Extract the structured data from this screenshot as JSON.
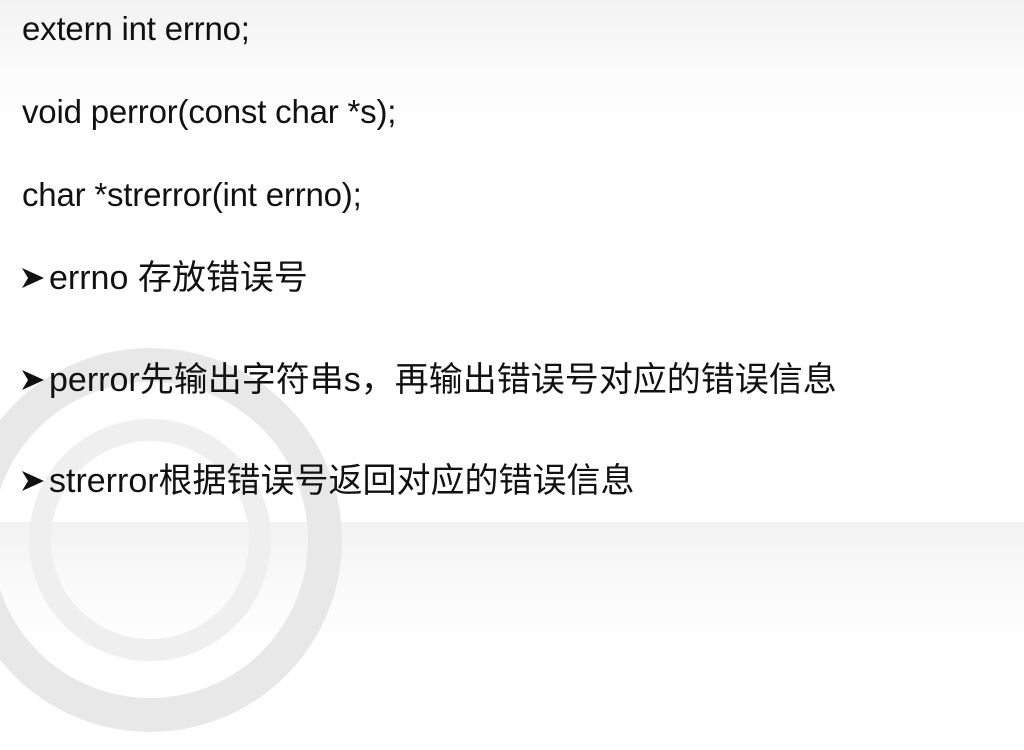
{
  "code_lines": [
    "extern int  errno;",
    "void perror(const char *s);",
    "char *strerror(int errno);"
  ],
  "bullets": [
    {
      "icon": "arrow-bullet-icon",
      "text": "errno 存放错误号"
    },
    {
      "icon": "arrow-bullet-icon",
      "text": "perror先输出字符串s，再输出错误号对应的错误信息"
    },
    {
      "icon": "arrow-bullet-icon",
      "text": "strerror根据错误号返回对应的错误信息"
    }
  ],
  "colors": {
    "text": "#111111",
    "watermark": "#e6e6e6",
    "background": "#ffffff"
  }
}
